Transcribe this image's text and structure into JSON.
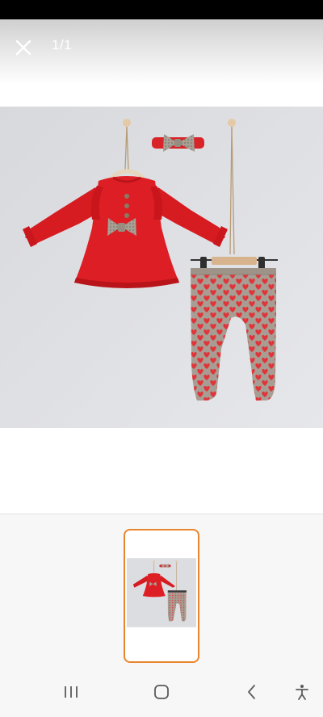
{
  "viewer": {
    "counter": "1/1"
  },
  "colors": {
    "accent": "#e8862e",
    "header_fade": "#cfcfcf"
  },
  "icons": {
    "close": "close-icon",
    "recent_apps": "recent-apps-icon",
    "home": "home-icon",
    "back": "back-icon",
    "accessibility": "accessibility-icon"
  }
}
